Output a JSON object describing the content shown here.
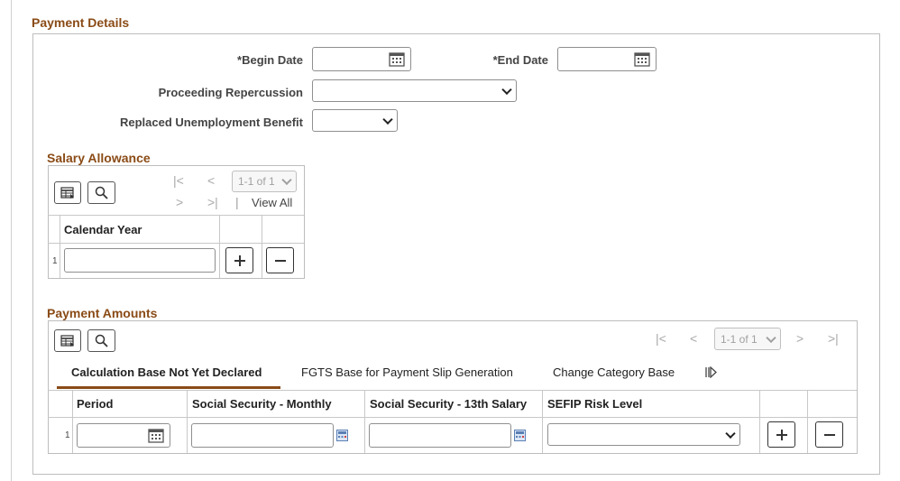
{
  "payment_details": {
    "title": "Payment Details",
    "begin_date_label": "*Begin Date",
    "begin_date_value": "",
    "end_date_label": "*End Date",
    "end_date_value": "",
    "proceeding_repercussion_label": "Proceeding Repercussion",
    "proceeding_repercussion_value": "",
    "replaced_unemployment_label": "Replaced Unemployment Benefit",
    "replaced_unemployment_value": ""
  },
  "salary_allowance": {
    "title": "Salary Allowance",
    "pager_text": "1-1 of 1",
    "view_all": "View All",
    "pager_separator": "|",
    "column_header": "Calendar Year",
    "rows": [
      {
        "num": "1",
        "calendar_year": ""
      }
    ]
  },
  "payment_amounts": {
    "title": "Payment Amounts",
    "pager_text": "1-1 of 1",
    "tabs": [
      {
        "label": "Calculation Base Not Yet Declared",
        "active": true
      },
      {
        "label": "FGTS Base for Payment Slip Generation",
        "active": false
      },
      {
        "label": "Change Category Base",
        "active": false
      }
    ],
    "columns": [
      "Period",
      "Social Security - Monthly",
      "Social Security - 13th Salary",
      "SEFIP Risk Level"
    ],
    "rows": [
      {
        "num": "1",
        "period": "",
        "ss_monthly": "",
        "ss_13th": "",
        "sefip": ""
      }
    ]
  },
  "icons": [
    "calendar-icon",
    "chevron-down-icon",
    "grid-personalize-icon",
    "search-icon",
    "first-page-icon",
    "previous-page-icon",
    "next-page-icon",
    "last-page-icon",
    "add-row-icon",
    "delete-row-icon",
    "more-tabs-icon",
    "calculator-icon"
  ],
  "colors": {
    "section_title": "#8a4b16",
    "tab_underline": "#8a4b16",
    "border": "#bdbdbd"
  }
}
